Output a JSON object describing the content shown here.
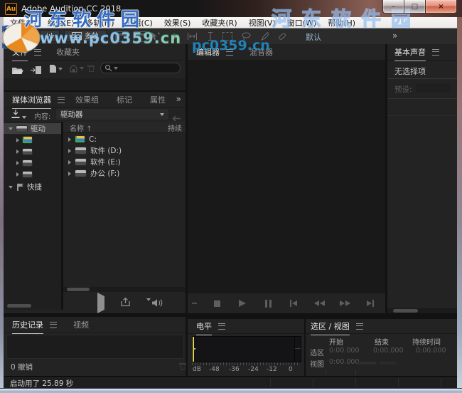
{
  "window": {
    "title": "Adobe Audition CC 2018",
    "app_logo": "Au",
    "controls": {
      "minimize": "–",
      "maximize": "□",
      "close": "×"
    }
  },
  "menu_bar": {
    "items": [
      "文件(F)",
      "编辑(E)",
      "多轨(M)",
      "剪辑(C)",
      "效果(S)",
      "收藏夹(R)",
      "视图(V)",
      "窗口(W)",
      "帮助(H)"
    ]
  },
  "toolbar": {
    "multitrack_label": "多轨",
    "workspace_label": "默认",
    "overflow_label": "»",
    "tool_icons": [
      "move-tool",
      "razor-tool",
      "slip-tool",
      "time-selection-tool",
      "marquee-selection-tool",
      "lasso-selection-tool",
      "paintbrush-tool",
      "spot-healing-brush-tool"
    ]
  },
  "watermark": {
    "site_name": "河东软件园",
    "site_url": "www.pc0359.cn",
    "site_url_short": "pc0359.cn"
  },
  "files_panel": {
    "tab_files": "文件",
    "tab_favorites": "收藏夹"
  },
  "media_browser": {
    "tab_media": "媒体浏览器",
    "tab_effects": "效果组",
    "tab_markers": "标记",
    "tab_properties": "属性",
    "overflow_label": "»",
    "content_label": "内容:",
    "content_value": "驱动器",
    "sort_indicator": "↑",
    "col_name": "名称",
    "col_duration": "持续",
    "tree_drives_label": "驱动",
    "tree_shortcuts_label": "快捷",
    "rows": [
      {
        "name": "C:"
      },
      {
        "name": "软件 (D:)"
      },
      {
        "name": "软件 (E:)"
      },
      {
        "name": "办公 (F:)"
      }
    ]
  },
  "history_panel": {
    "tab_history": "历史记录",
    "tab_video": "视频",
    "undo_status": "0 撤销"
  },
  "editor_panel": {
    "tab_editor": "编辑器",
    "tab_mixer": "混音器",
    "transport_icons": [
      "stop",
      "play",
      "pause",
      "skip-to-start",
      "rewind",
      "fast-forward",
      "skip-to-end"
    ]
  },
  "essential_sound": {
    "title": "基本声音",
    "message": "无选择项",
    "preset_label": "预设:"
  },
  "levels_panel": {
    "title": "电平",
    "scale": [
      "dB",
      "-48",
      "-36",
      "-24",
      "-12",
      "0"
    ]
  },
  "selection_view_panel": {
    "title": "选区 / 视图",
    "columns": [
      "开始",
      "结束",
      "持续时间"
    ],
    "rows": [
      {
        "label": "选区",
        "start": "0:00.000",
        "end": "0:00.000",
        "duration": "0:00.000"
      },
      {
        "label": "视图",
        "start": "0:00.000",
        "end": "",
        "duration": ""
      }
    ]
  },
  "status_bar": {
    "message": "启动用了 25.89 秒"
  },
  "colors": {
    "accent_watermark_blue": "#2260bc",
    "watermark_green": "#18a24c",
    "workspace_text_blue": "#9cb9d2",
    "meter_yellow": "#d9cf52",
    "close_button_red": "#cd6148",
    "panel_bg": "#232323",
    "content_bg": "#191919"
  }
}
